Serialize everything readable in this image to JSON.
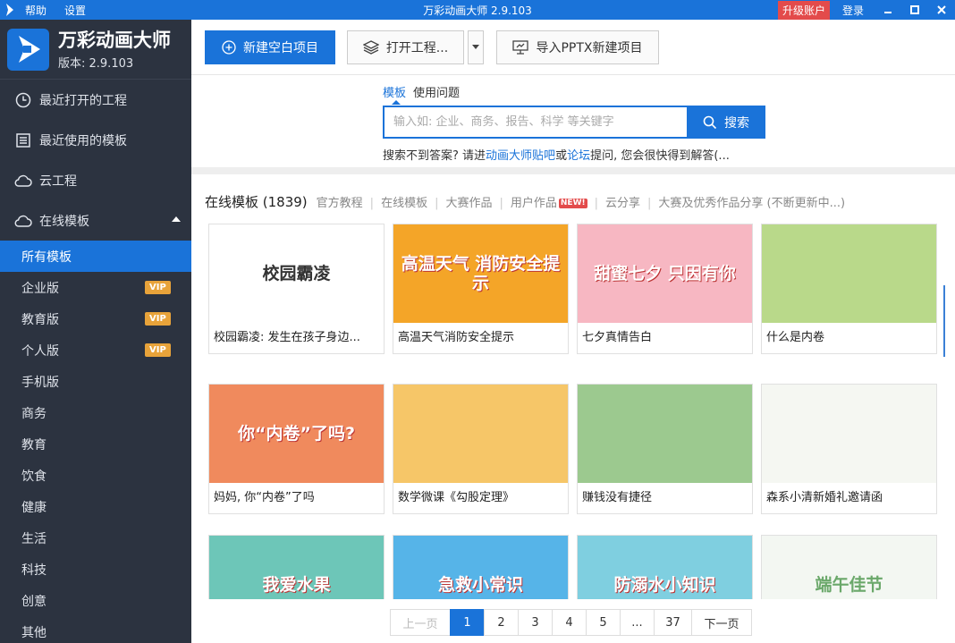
{
  "titlebar": {
    "menu": [
      "帮助",
      "设置"
    ],
    "title": "万彩动画大师 2.9.103",
    "upgrade_label": "升级账户",
    "login_label": "登录",
    "window_controls": [
      "minimize-icon",
      "maximize-icon",
      "close-icon"
    ]
  },
  "brand": {
    "name": "万彩动画大师",
    "version": "版本: 2.9.103"
  },
  "sidebar": {
    "main_items": [
      {
        "label": "最近打开的工程",
        "icon": "clock-icon"
      },
      {
        "label": "最近使用的模板",
        "icon": "template-list-icon"
      },
      {
        "label": "云工程",
        "icon": "cloud-icon"
      },
      {
        "label": "在线模板",
        "icon": "cloud-icon",
        "expanded": true
      }
    ],
    "sub_items": [
      {
        "label": "所有模板",
        "active": true,
        "vip": false
      },
      {
        "label": "企业版",
        "active": false,
        "vip": true
      },
      {
        "label": "教育版",
        "active": false,
        "vip": true
      },
      {
        "label": "个人版",
        "active": false,
        "vip": true
      },
      {
        "label": "手机版",
        "active": false,
        "vip": false
      },
      {
        "label": "商务",
        "active": false,
        "vip": false
      },
      {
        "label": "教育",
        "active": false,
        "vip": false
      },
      {
        "label": "饮食",
        "active": false,
        "vip": false
      },
      {
        "label": "健康",
        "active": false,
        "vip": false
      },
      {
        "label": "生活",
        "active": false,
        "vip": false
      },
      {
        "label": "科技",
        "active": false,
        "vip": false
      },
      {
        "label": "创意",
        "active": false,
        "vip": false
      },
      {
        "label": "其他",
        "active": false,
        "vip": false
      }
    ],
    "vip_label": "VIP"
  },
  "toolbar": {
    "new_project": "新建空白项目",
    "open_project": "打开工程...",
    "import_pptx": "导入PPTX新建项目"
  },
  "search": {
    "tabs": [
      {
        "label": "模板",
        "active": true
      },
      {
        "label": "使用问题",
        "active": false
      }
    ],
    "placeholder": "输入如: 企业、商务、报告、科学 等关键字",
    "button_label": "搜索",
    "help_prefix": "搜索不到答案? 请进",
    "help_link1": "动画大师贴吧",
    "help_mid": "或",
    "help_link2": "论坛",
    "help_suffix": "提问, 您会很快得到解答(..."
  },
  "section": {
    "title": "在线模板 (1839)",
    "links": [
      {
        "label": "官方教程",
        "new": false
      },
      {
        "label": "在线模板",
        "new": false
      },
      {
        "label": "大赛作品",
        "new": false
      },
      {
        "label": "用户作品",
        "new": true
      },
      {
        "label": "云分享",
        "new": false
      },
      {
        "label": "大赛及优秀作品分享 (不断更新中...)",
        "new": false
      }
    ],
    "new_badge": "NEW!"
  },
  "templates": [
    {
      "title": "校园霸凌: 发生在孩子身边...",
      "thumb_text": "校园霸凌",
      "bg": "#ffffff",
      "fg": "#333333"
    },
    {
      "title": "高温天气消防安全提示",
      "thumb_text": "高温天气 消防安全提示",
      "bg": "#f4a528",
      "fg": "#ffffff"
    },
    {
      "title": "七夕真情告白",
      "thumb_text": "甜蜜七夕 只因有你",
      "bg": "#f7b7c2",
      "fg": "#ffffff"
    },
    {
      "title": "什么是内卷",
      "thumb_text": "",
      "bg": "#b9d98a",
      "fg": "#ffffff"
    },
    {
      "title": "妈妈, 你“内卷”了吗",
      "thumb_text": "你“内卷”了吗?",
      "bg": "#f08a5d",
      "fg": "#ffffff"
    },
    {
      "title": "数学微课《勾股定理》",
      "thumb_text": "",
      "bg": "#f6c668",
      "fg": "#ffffff"
    },
    {
      "title": "赚钱没有捷径",
      "thumb_text": "",
      "bg": "#9cc98f",
      "fg": "#ffffff"
    },
    {
      "title": "森系小清新婚礼邀请函",
      "thumb_text": "",
      "bg": "#f5f7f2",
      "fg": "#7aa272"
    },
    {
      "title": "",
      "thumb_text": "我爱水果",
      "bg": "#6dc6b8",
      "fg": "#ffffff"
    },
    {
      "title": "",
      "thumb_text": "急救小常识",
      "bg": "#56b4e8",
      "fg": "#ffffff"
    },
    {
      "title": "",
      "thumb_text": "防溺水小知识",
      "bg": "#7fcfe0",
      "fg": "#ffffff"
    },
    {
      "title": "",
      "thumb_text": "端午佳节",
      "bg": "#f3f7f2",
      "fg": "#6aa86a"
    }
  ],
  "pagination": {
    "prev": "上一页",
    "pages": [
      "1",
      "2",
      "3",
      "4",
      "5",
      "...",
      "37"
    ],
    "active": "1",
    "next": "下一页"
  },
  "colors": {
    "accent": "#1a73d9",
    "sidebar_bg": "#2c3340",
    "vip": "#e8a33a",
    "upgrade": "#e34b4b"
  }
}
